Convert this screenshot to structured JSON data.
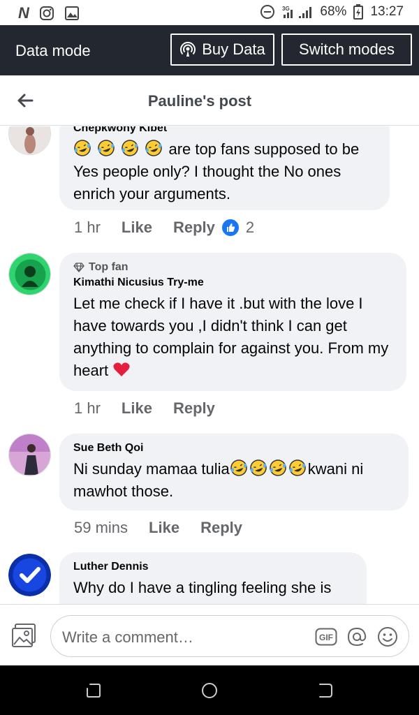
{
  "status_bar": {
    "battery": "68%",
    "time": "13:27",
    "network": "3G"
  },
  "data_bar": {
    "title": "Data mode",
    "buy_label": "Buy Data",
    "switch_label": "Switch modes"
  },
  "header": {
    "title": "Pauline's post"
  },
  "comments": [
    {
      "name": "Chepkwony Kibet",
      "text": "are top fans supposed to be Yes people only? I thought the No ones enrich your arguments.",
      "time": "1 hr",
      "like_label": "Like",
      "reply_label": "Reply",
      "reaction_count": "2"
    },
    {
      "badge": "Top fan",
      "name": "Kimathi Nicusius Try-me",
      "text": "Let me check if I have it .but with the love I have towards you ,I didn't think I can get anything to complain for against you. From my heart",
      "time": "1 hr",
      "like_label": "Like",
      "reply_label": "Reply"
    },
    {
      "name": "Sue Beth Qoi",
      "text_before": "Ni sunday mamaa tulia",
      "text_after": "kwani ni mawhot those.",
      "time": "59 mins",
      "like_label": "Like",
      "reply_label": "Reply"
    },
    {
      "name": "Luther Dennis",
      "text": "Why do I have a tingling feeling she is"
    }
  ],
  "composer": {
    "placeholder": "Write a comment…",
    "gif_label": "GIF"
  },
  "colors": {
    "data_bar_bg": "#23272f",
    "bubble_bg": "#f0f2f5",
    "like_blue": "#1877f2",
    "heart_red": "#e41e3f"
  },
  "icons": [
    "back-arrow-icon",
    "broadcast-icon",
    "thumbs-up-icon",
    "heart-icon",
    "laughing-emoji-icon",
    "diamond-icon",
    "photo-icon",
    "gif-icon",
    "at-sign-icon",
    "smiley-icon",
    "recent-apps-icon",
    "home-icon",
    "back-nav-icon"
  ]
}
